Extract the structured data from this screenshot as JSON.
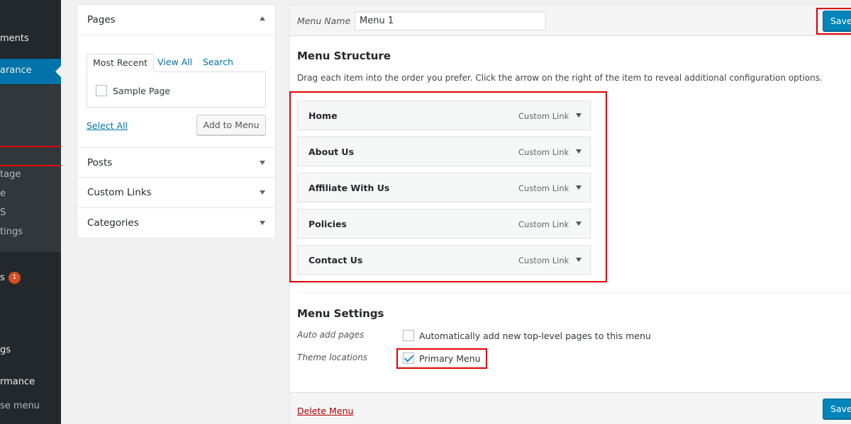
{
  "admin_menu": {
    "items": [
      {
        "label": "ments"
      },
      {
        "label": "arance"
      },
      {
        "label": "tage"
      },
      {
        "label": "e"
      },
      {
        "label": "S"
      },
      {
        "label": "tings"
      },
      {
        "label": "s"
      },
      {
        "label": "gs"
      },
      {
        "label": "rmance"
      },
      {
        "label": "se menu"
      }
    ],
    "badge": "1",
    "accent_color": "#0073aa"
  },
  "accordion": {
    "sections": [
      {
        "title": "Pages",
        "expanded": true
      },
      {
        "title": "Posts"
      },
      {
        "title": "Custom Links"
      },
      {
        "title": "Categories"
      }
    ],
    "tabs": [
      "Most Recent",
      "View All",
      "Search"
    ],
    "active_tab": "Most Recent",
    "items": [
      {
        "label": "Sample Page",
        "checked": false
      }
    ],
    "select_all": "Select All",
    "add_button": "Add to Menu"
  },
  "management": {
    "menu_name_label": "Menu Name",
    "menu_name_value": "Menu 1",
    "save_label": "Save",
    "structure_title": "Menu Structure",
    "structure_desc": "Drag each item into the order you prefer. Click the arrow on the right of the item to reveal additional configuration options.",
    "items": [
      {
        "title": "Home",
        "type": "Custom Link"
      },
      {
        "title": "About Us",
        "type": "Custom Link"
      },
      {
        "title": "Affiliate With Us",
        "type": "Custom Link"
      },
      {
        "title": "Policies",
        "type": "Custom Link"
      },
      {
        "title": "Contact Us",
        "type": "Custom Link"
      }
    ],
    "settings_title": "Menu Settings",
    "auto_add_label": "Auto add pages",
    "auto_add_text": "Automatically add new top-level pages to this menu",
    "auto_add_checked": false,
    "theme_locations_label": "Theme locations",
    "primary_menu_text": "Primary Menu",
    "primary_menu_checked": true,
    "delete_label": "Delete Menu"
  },
  "colors": {
    "primary_button": "#0085ba",
    "highlight": "#e00000",
    "link": "#0073aa",
    "delete": "#a00"
  }
}
